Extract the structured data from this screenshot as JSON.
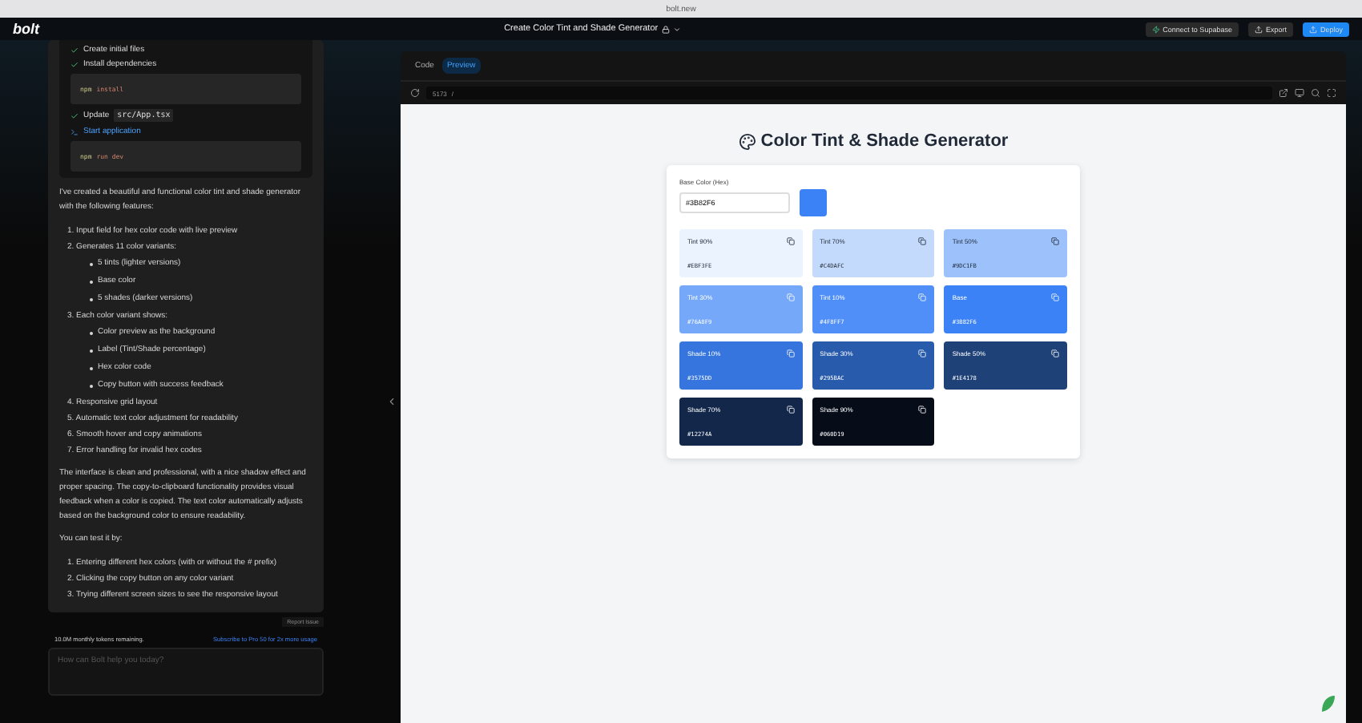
{
  "browser": {
    "url": "bolt.new"
  },
  "header": {
    "logo": "bolt",
    "title": "Create Color Tint and Shade Generator",
    "buttons": [
      {
        "label": "Connect to Supabase",
        "kind": "dark"
      },
      {
        "label": "Export",
        "kind": "dark"
      },
      {
        "label": "Deploy",
        "kind": "primary"
      }
    ]
  },
  "chat": {
    "steps": [
      {
        "kind": "step",
        "label": "Create initial files",
        "running": false
      },
      {
        "kind": "step",
        "label": "Install dependencies",
        "running": false
      },
      {
        "kind": "code",
        "prefix": "npm",
        "command": "install"
      },
      {
        "kind": "step",
        "label": "Update",
        "file": "src/App.tsx",
        "running": false
      },
      {
        "kind": "step",
        "label": "Start application",
        "running": true
      },
      {
        "kind": "code",
        "prefix": "npm",
        "command": "run dev"
      }
    ],
    "message": [
      {
        "kind": "paragraph",
        "text": "I've created a beautiful and functional color tint and shade generator with the following features:"
      },
      {
        "kind": "list",
        "items": [
          {
            "text": "1. Input field for hex color code with live preview"
          },
          {
            "text": "2. Generates 11 color variants:",
            "children": [
              "5 tints (lighter versions)",
              "Base color",
              "5 shades (darker versions)"
            ]
          },
          {
            "text": "3. Each color variant shows:",
            "children": [
              "Color preview as the background",
              "Label (Tint/Shade percentage)",
              "Hex color code",
              "Copy button with success feedback"
            ]
          },
          {
            "text": "4. Responsive grid layout"
          },
          {
            "text": "5. Automatic text color adjustment for readability"
          },
          {
            "text": "6. Smooth hover and copy animations"
          },
          {
            "text": "7. Error handling for invalid hex codes"
          }
        ]
      },
      {
        "kind": "paragraph",
        "text": "The interface is clean and professional, with a nice shadow effect and proper spacing. The copy-to-clipboard functionality provides visual feedback when a color is copied. The text color automatically adjusts based on the background color to ensure readability."
      },
      {
        "kind": "paragraph",
        "text": "You can test it by:"
      },
      {
        "kind": "list",
        "items": [
          {
            "text": "1. Entering different hex colors (with or without the # prefix)"
          },
          {
            "text": "2. Clicking the copy button on any color variant"
          },
          {
            "text": "3. Trying different screen sizes to see the responsive layout"
          }
        ]
      }
    ],
    "report": "Report Issue",
    "tokens": "10.0M monthly tokens remaining.",
    "subscribe": "Subscribe to Pro 50 for 2x more usage",
    "placeholder": "How can Bolt help you today?"
  },
  "workbench": {
    "tabs": [
      {
        "label": "Code",
        "selected": false
      },
      {
        "label": "Preview",
        "selected": true
      }
    ],
    "port": "5173",
    "path": "/"
  },
  "preview": {
    "title": "Color Tint & Shade Generator",
    "input_label": "Base Color (Hex)",
    "input_value": "#3B82F6",
    "swatches": [
      {
        "label": "Tint 90%",
        "hex": "#EBF3FE",
        "color": "#ebf3fe"
      },
      {
        "label": "Tint 70%",
        "hex": "#C4DAFC",
        "color": "#c4dafc"
      },
      {
        "label": "Tint 50%",
        "hex": "#9DC1FB",
        "color": "#9dc1fb"
      },
      {
        "label": "Tint 30%",
        "hex": "#76A8F9",
        "color": "#76a8f9"
      },
      {
        "label": "Tint 10%",
        "hex": "#4F8FF7",
        "color": "#4f8ff7"
      },
      {
        "label": "Base",
        "hex": "#3B82F6",
        "color": "#3b82f6"
      },
      {
        "label": "Shade 10%",
        "hex": "#3575DD",
        "color": "#3575dd"
      },
      {
        "label": "Shade 30%",
        "hex": "#295BAC",
        "color": "#295bac"
      },
      {
        "label": "Shade 50%",
        "hex": "#1E4178",
        "color": "#1e4178"
      },
      {
        "label": "Shade 70%",
        "hex": "#12274A",
        "color": "#12274a"
      },
      {
        "label": "Shade 90%",
        "hex": "#060D19",
        "color": "#060d19"
      }
    ]
  }
}
